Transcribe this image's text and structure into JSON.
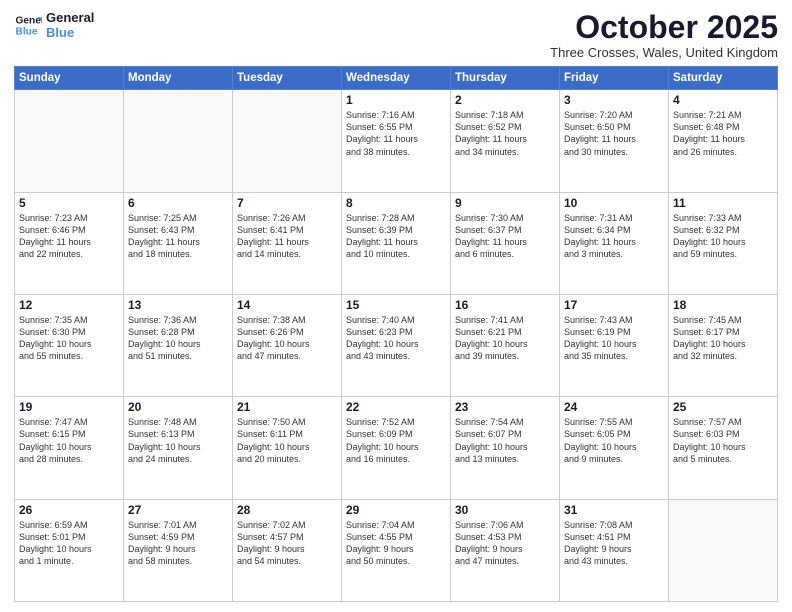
{
  "header": {
    "logo_line1": "General",
    "logo_line2": "Blue",
    "month": "October 2025",
    "location": "Three Crosses, Wales, United Kingdom"
  },
  "weekdays": [
    "Sunday",
    "Monday",
    "Tuesday",
    "Wednesday",
    "Thursday",
    "Friday",
    "Saturday"
  ],
  "weeks": [
    [
      {
        "day": "",
        "text": ""
      },
      {
        "day": "",
        "text": ""
      },
      {
        "day": "",
        "text": ""
      },
      {
        "day": "1",
        "text": "Sunrise: 7:16 AM\nSunset: 6:55 PM\nDaylight: 11 hours\nand 38 minutes."
      },
      {
        "day": "2",
        "text": "Sunrise: 7:18 AM\nSunset: 6:52 PM\nDaylight: 11 hours\nand 34 minutes."
      },
      {
        "day": "3",
        "text": "Sunrise: 7:20 AM\nSunset: 6:50 PM\nDaylight: 11 hours\nand 30 minutes."
      },
      {
        "day": "4",
        "text": "Sunrise: 7:21 AM\nSunset: 6:48 PM\nDaylight: 11 hours\nand 26 minutes."
      }
    ],
    [
      {
        "day": "5",
        "text": "Sunrise: 7:23 AM\nSunset: 6:46 PM\nDaylight: 11 hours\nand 22 minutes."
      },
      {
        "day": "6",
        "text": "Sunrise: 7:25 AM\nSunset: 6:43 PM\nDaylight: 11 hours\nand 18 minutes."
      },
      {
        "day": "7",
        "text": "Sunrise: 7:26 AM\nSunset: 6:41 PM\nDaylight: 11 hours\nand 14 minutes."
      },
      {
        "day": "8",
        "text": "Sunrise: 7:28 AM\nSunset: 6:39 PM\nDaylight: 11 hours\nand 10 minutes."
      },
      {
        "day": "9",
        "text": "Sunrise: 7:30 AM\nSunset: 6:37 PM\nDaylight: 11 hours\nand 6 minutes."
      },
      {
        "day": "10",
        "text": "Sunrise: 7:31 AM\nSunset: 6:34 PM\nDaylight: 11 hours\nand 3 minutes."
      },
      {
        "day": "11",
        "text": "Sunrise: 7:33 AM\nSunset: 6:32 PM\nDaylight: 10 hours\nand 59 minutes."
      }
    ],
    [
      {
        "day": "12",
        "text": "Sunrise: 7:35 AM\nSunset: 6:30 PM\nDaylight: 10 hours\nand 55 minutes."
      },
      {
        "day": "13",
        "text": "Sunrise: 7:36 AM\nSunset: 6:28 PM\nDaylight: 10 hours\nand 51 minutes."
      },
      {
        "day": "14",
        "text": "Sunrise: 7:38 AM\nSunset: 6:26 PM\nDaylight: 10 hours\nand 47 minutes."
      },
      {
        "day": "15",
        "text": "Sunrise: 7:40 AM\nSunset: 6:23 PM\nDaylight: 10 hours\nand 43 minutes."
      },
      {
        "day": "16",
        "text": "Sunrise: 7:41 AM\nSunset: 6:21 PM\nDaylight: 10 hours\nand 39 minutes."
      },
      {
        "day": "17",
        "text": "Sunrise: 7:43 AM\nSunset: 6:19 PM\nDaylight: 10 hours\nand 35 minutes."
      },
      {
        "day": "18",
        "text": "Sunrise: 7:45 AM\nSunset: 6:17 PM\nDaylight: 10 hours\nand 32 minutes."
      }
    ],
    [
      {
        "day": "19",
        "text": "Sunrise: 7:47 AM\nSunset: 6:15 PM\nDaylight: 10 hours\nand 28 minutes."
      },
      {
        "day": "20",
        "text": "Sunrise: 7:48 AM\nSunset: 6:13 PM\nDaylight: 10 hours\nand 24 minutes."
      },
      {
        "day": "21",
        "text": "Sunrise: 7:50 AM\nSunset: 6:11 PM\nDaylight: 10 hours\nand 20 minutes."
      },
      {
        "day": "22",
        "text": "Sunrise: 7:52 AM\nSunset: 6:09 PM\nDaylight: 10 hours\nand 16 minutes."
      },
      {
        "day": "23",
        "text": "Sunrise: 7:54 AM\nSunset: 6:07 PM\nDaylight: 10 hours\nand 13 minutes."
      },
      {
        "day": "24",
        "text": "Sunrise: 7:55 AM\nSunset: 6:05 PM\nDaylight: 10 hours\nand 9 minutes."
      },
      {
        "day": "25",
        "text": "Sunrise: 7:57 AM\nSunset: 6:03 PM\nDaylight: 10 hours\nand 5 minutes."
      }
    ],
    [
      {
        "day": "26",
        "text": "Sunrise: 6:59 AM\nSunset: 5:01 PM\nDaylight: 10 hours\nand 1 minute."
      },
      {
        "day": "27",
        "text": "Sunrise: 7:01 AM\nSunset: 4:59 PM\nDaylight: 9 hours\nand 58 minutes."
      },
      {
        "day": "28",
        "text": "Sunrise: 7:02 AM\nSunset: 4:57 PM\nDaylight: 9 hours\nand 54 minutes."
      },
      {
        "day": "29",
        "text": "Sunrise: 7:04 AM\nSunset: 4:55 PM\nDaylight: 9 hours\nand 50 minutes."
      },
      {
        "day": "30",
        "text": "Sunrise: 7:06 AM\nSunset: 4:53 PM\nDaylight: 9 hours\nand 47 minutes."
      },
      {
        "day": "31",
        "text": "Sunrise: 7:08 AM\nSunset: 4:51 PM\nDaylight: 9 hours\nand 43 minutes."
      },
      {
        "day": "",
        "text": ""
      }
    ]
  ]
}
